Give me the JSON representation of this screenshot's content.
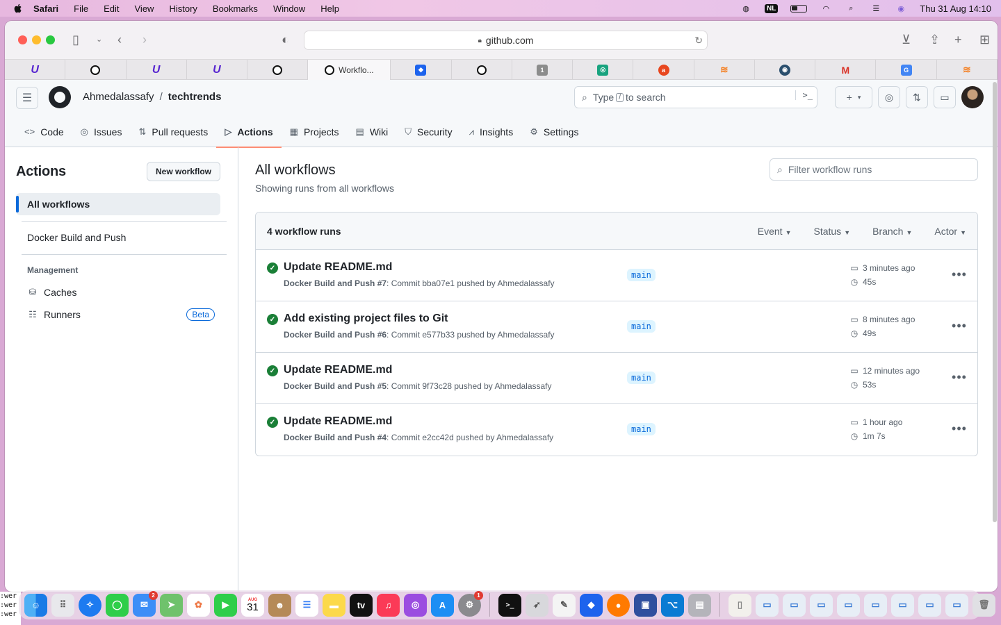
{
  "menubar": {
    "app": "Safari",
    "items": [
      "File",
      "Edit",
      "View",
      "History",
      "Bookmarks",
      "Window",
      "Help"
    ],
    "input_badge": "NL",
    "clock": "Thu 31 Aug  14:10"
  },
  "browser": {
    "url": "github.com",
    "active_tab_title": "Workflo..."
  },
  "github": {
    "owner": "Ahmedalassafy",
    "separator": "/",
    "repo": "techtrends",
    "search": {
      "prefix": "Type",
      "key": "/",
      "suffix": "to search"
    },
    "nav": [
      {
        "label": "Code",
        "icon": "code-icon"
      },
      {
        "label": "Issues",
        "icon": "issue-icon"
      },
      {
        "label": "Pull requests",
        "icon": "pull-request-icon"
      },
      {
        "label": "Actions",
        "icon": "play-icon"
      },
      {
        "label": "Projects",
        "icon": "table-icon"
      },
      {
        "label": "Wiki",
        "icon": "book-icon"
      },
      {
        "label": "Security",
        "icon": "shield-icon"
      },
      {
        "label": "Insights",
        "icon": "graph-icon"
      },
      {
        "label": "Settings",
        "icon": "gear-icon"
      }
    ],
    "selected_nav": "Actions"
  },
  "sidebar": {
    "title": "Actions",
    "new_workflow": "New workflow",
    "all_workflows": "All workflows",
    "workflow": "Docker Build and Push",
    "management": "Management",
    "caches": "Caches",
    "runners": "Runners",
    "beta": "Beta"
  },
  "main": {
    "title": "All workflows",
    "subtitle": "Showing runs from all workflows",
    "filter_placeholder": "Filter workflow runs",
    "runs_count": "4 workflow runs",
    "filters": [
      "Event",
      "Status",
      "Branch",
      "Actor"
    ],
    "runs": [
      {
        "title": "Update README.md",
        "workflow": "Docker Build and Push #7",
        "meta": ": Commit bba07e1 pushed by Ahmedalassafy",
        "branch": "main",
        "when": "3 minutes ago",
        "duration": "45s",
        "status": "success"
      },
      {
        "title": "Add existing project files to Git",
        "workflow": "Docker Build and Push #6",
        "meta": ": Commit e577b33 pushed by Ahmedalassafy",
        "branch": "main",
        "when": "8 minutes ago",
        "duration": "49s",
        "status": "success"
      },
      {
        "title": "Update README.md",
        "workflow": "Docker Build and Push #5",
        "meta": ": Commit 9f73c28 pushed by Ahmedalassafy",
        "branch": "main",
        "when": "12 minutes ago",
        "duration": "53s",
        "status": "success"
      },
      {
        "title": "Update README.md",
        "workflow": "Docker Build and Push #4",
        "meta": ": Commit e2cc42d pushed by Ahmedalassafy",
        "branch": "main",
        "when": "1 hour ago",
        "duration": "1m 7s",
        "status": "success"
      }
    ]
  },
  "dock": {
    "calendar_month": "AUG",
    "calendar_day": "31",
    "mail_badge": "2",
    "settings_badge": "1"
  },
  "terminal_fragment": [
    ":wer",
    ":wer",
    ":wer"
  ],
  "colors": {
    "success": "#1a7f37",
    "accent_blue": "#0969da",
    "underline": "#fd8c73"
  }
}
